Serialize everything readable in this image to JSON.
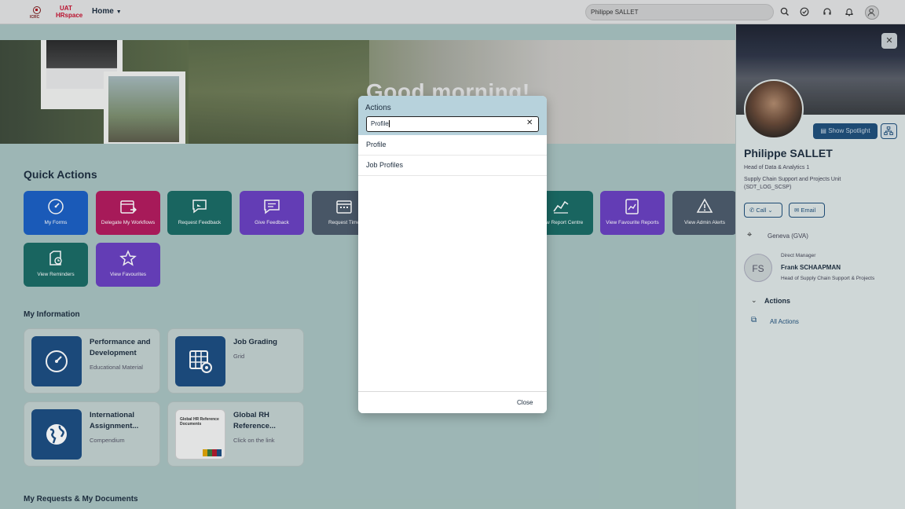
{
  "header": {
    "logo_org": "ICRC",
    "logo_env": "UAT",
    "logo_app": "HRspace",
    "home_label": "Home",
    "search_value": "Philippe SALLET",
    "icons": [
      "search-icon",
      "check-circle-icon",
      "headset-icon",
      "bell-icon",
      "user-icon"
    ]
  },
  "banner": {
    "greeting": "Good morning!"
  },
  "quick_actions": {
    "title": "Quick Actions",
    "tiles": [
      {
        "label": "My Forms",
        "color": "#1b5fc4",
        "icon": "gauge-icon"
      },
      {
        "label": "Delegate My Workflows",
        "color": "#b41a5d",
        "icon": "calendar-arrow-icon"
      },
      {
        "label": "Request Feedback",
        "color": "#1a6b64",
        "icon": "feedback-icon"
      },
      {
        "label": "Give Feedback",
        "color": "#6a3fc1",
        "icon": "message-icon"
      },
      {
        "label": "Request Time",
        "color": "#4c5b6b",
        "icon": "calendar-icon"
      },
      {
        "label": "View Report Centre",
        "color": "#1a6b64",
        "icon": "line-chart-icon"
      },
      {
        "label": "View Favourite Reports",
        "color": "#6a3fc1",
        "icon": "report-icon"
      },
      {
        "label": "View Admin Alerts",
        "color": "#4c5b6b",
        "icon": "alert-icon"
      },
      {
        "label": "View Reminders",
        "color": "#1a6b64",
        "icon": "reminder-icon"
      },
      {
        "label": "View Favourites",
        "color": "#6a3fc1",
        "icon": "star-icon"
      }
    ]
  },
  "my_information": {
    "title": "My Information",
    "cards": [
      {
        "title": "Performance and Development",
        "subtitle": "Educational Material"
      },
      {
        "title": "Job Grading",
        "subtitle": "Grid"
      },
      {
        "title": "International Assignment...",
        "subtitle": "Compendium"
      },
      {
        "title": "Global RH Reference...",
        "subtitle": "Click on the link",
        "thumb_text": "Global HR Reference Documents"
      }
    ]
  },
  "my_requests": {
    "title": "My Requests & My Documents"
  },
  "profile_panel": {
    "show_spotlight": "Show Spotlight",
    "name": "Philippe SALLET",
    "job_title": "Head of Data & Analytics 1",
    "unit": "Supply Chain Support and Projects Unit (SDT_LOG_SCSP)",
    "call_label": "Call",
    "email_label": "Email",
    "location": "Geneva (GVA)",
    "manager_caption": "Direct Manager",
    "manager_initials": "FS",
    "manager_name": "Frank SCHAAPMAN",
    "manager_title": "Head of Supply Chain Support & Projects",
    "actions_heading": "Actions",
    "all_actions": "All Actions"
  },
  "dialog": {
    "title": "Actions",
    "search_value": "Profile",
    "results": [
      "Profile",
      "Job Profiles"
    ],
    "close_label": "Close"
  }
}
